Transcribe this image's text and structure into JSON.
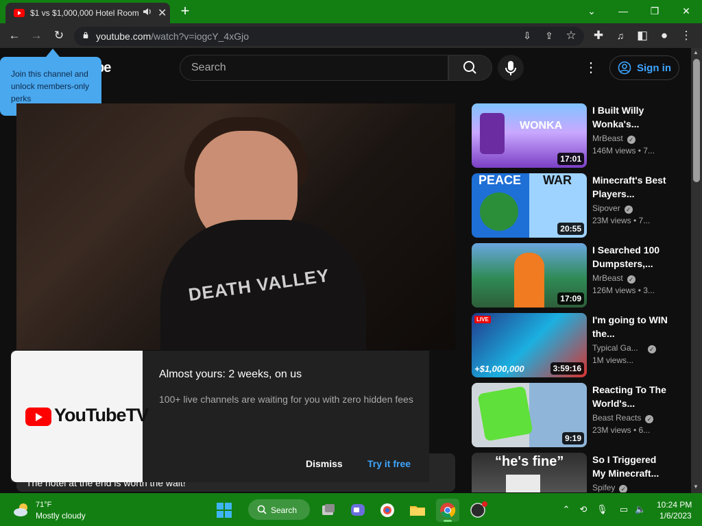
{
  "browser": {
    "tab_title": "$1 vs $1,000,000 Hotel Room",
    "new_tab": "+",
    "url_domain": "youtube.com",
    "url_rest": "/watch?v=iogcY_4xGjo"
  },
  "masthead": {
    "logo_fragment": "be",
    "search_placeholder": "Search",
    "signin_label": "Sign in"
  },
  "tooltip": {
    "text": "Join this channel and unlock members-only perks"
  },
  "video": {
    "shirt_text": "DEATH VALLEY",
    "description_snippet": "The hotel at the end is worth the wait!"
  },
  "promo": {
    "logo_word": "YouTubeTV",
    "title": "Almost yours: 2 weeks, on us",
    "body": "100+ live channels are waiting for you with zero hidden fees",
    "dismiss_label": "Dismiss",
    "try_label": "Try it free"
  },
  "recommendations": [
    {
      "title": "I Built Willy Wonka's...",
      "channel": "MrBeast",
      "verified": true,
      "meta": "146M views • 7...",
      "duration": "17:01",
      "thumb_text": "WONKA"
    },
    {
      "title": "Minecraft's Best Players...",
      "channel": "Sipover",
      "verified": true,
      "meta": "23M views • 7...",
      "duration": "20:55",
      "thumb_text_left": "PEACE",
      "thumb_text_right": "WAR"
    },
    {
      "title": "I Searched 100 Dumpsters,...",
      "channel": "MrBeast",
      "verified": true,
      "meta": "126M views • 3...",
      "duration": "17:09"
    },
    {
      "title": "I'm going to WIN the...",
      "channel": "Typical Ga...",
      "verified": true,
      "meta": "1M views...",
      "duration": "3:59:16",
      "thumb_text": "+$1,000,000",
      "live_badge": "LIVE"
    },
    {
      "title": "Reacting To The World's...",
      "channel": "Beast Reacts",
      "verified": true,
      "meta": "23M views • 6...",
      "duration": "9:19"
    },
    {
      "title": "So I Triggered My Minecraft...",
      "channel": "Spifey",
      "verified": true,
      "meta": "",
      "duration": "",
      "thumb_text": "“he's fine”"
    }
  ],
  "taskbar": {
    "weather_temp": "71°F",
    "weather_desc": "Mostly cloudy",
    "search_label": "Search",
    "time": "10:24 PM",
    "date": "1/6/2023"
  },
  "colors": {
    "chrome_green": "#137f13",
    "youtube_bg": "#0f0f0f",
    "link_blue": "#3ea6ff",
    "tooltip_blue": "#4aa8ef",
    "youtube_red": "#ff0000"
  }
}
